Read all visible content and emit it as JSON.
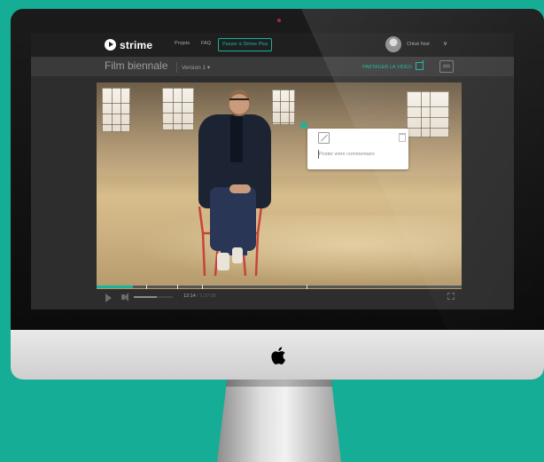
{
  "app": {
    "brand": "strime",
    "nav": {
      "projects": "Projets",
      "faq": "FAQ"
    },
    "upgrade_label": "Passer à Strime Plus",
    "user_name": "Chloé Noé",
    "user_chevron": "∨"
  },
  "project": {
    "title": "Film biennale",
    "version_label": "Version 1 ▾",
    "share_label": "PARTAGER LA VIDÉO"
  },
  "comment": {
    "placeholder": "Poster votre commentaire"
  },
  "player": {
    "current_time": "12:14",
    "separator": " / ",
    "total_time": "1:27:00",
    "progress": 0.1,
    "volume": 0.6,
    "timeline_markers": [
      0.135,
      0.22,
      0.29,
      0.575
    ]
  },
  "colors": {
    "accent": "#18b39b",
    "background": "#15ad96"
  }
}
